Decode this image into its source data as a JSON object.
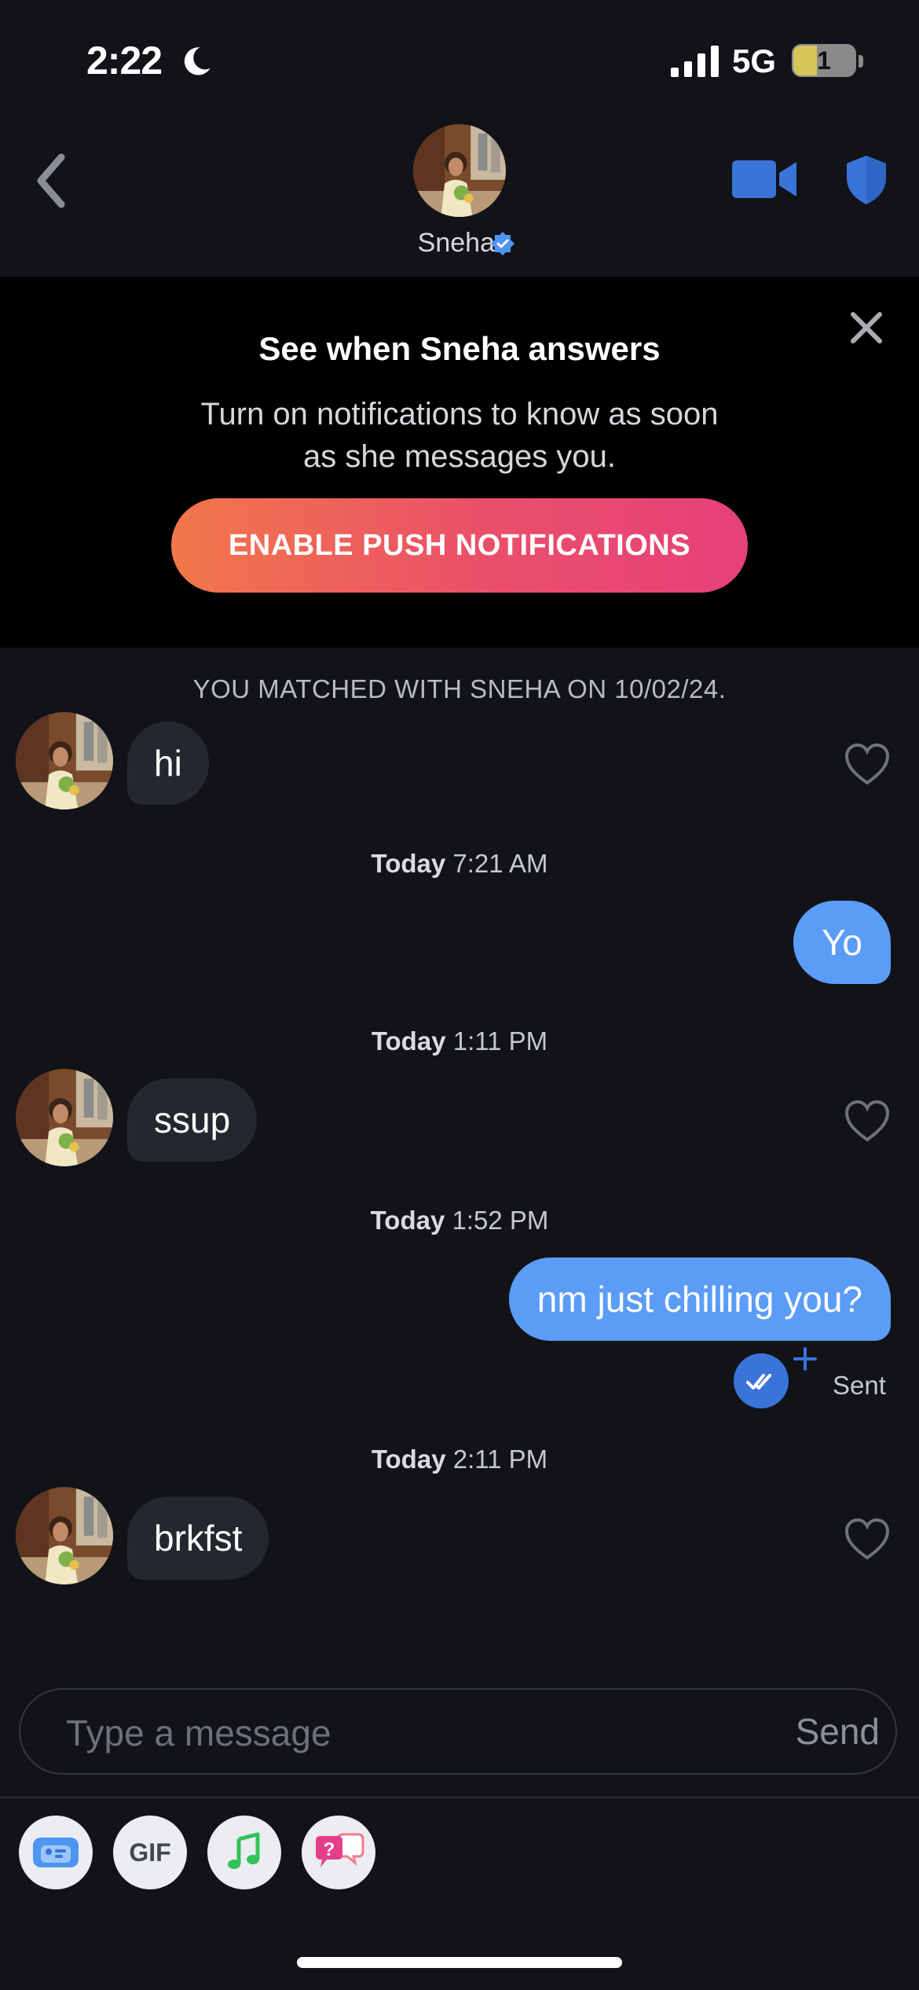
{
  "status_bar": {
    "time": "2:22",
    "network": "5G",
    "battery": "1"
  },
  "header": {
    "name": "Sneha"
  },
  "banner": {
    "title": "See when Sneha answers",
    "body": "Turn on notifications to know as soon as she messages you.",
    "button_label": "ENABLE PUSH NOTIFICATIONS"
  },
  "chat": {
    "matched_text": "YOU MATCHED WITH SNEHA ON 10/02/24.",
    "messages": [
      {
        "from": "them",
        "text": "hi"
      },
      {
        "day": "Today",
        "time": "7:21 AM"
      },
      {
        "from": "me",
        "text": "Yo"
      },
      {
        "day": "Today",
        "time": "1:11 PM"
      },
      {
        "from": "them",
        "text": "ssup"
      },
      {
        "day": "Today",
        "time": "1:52 PM"
      },
      {
        "from": "me",
        "text": "nm just chilling you?"
      },
      {
        "day": "Today",
        "time": "2:11 PM"
      },
      {
        "from": "them",
        "text": "brkfst"
      }
    ],
    "receipt_status": "Sent"
  },
  "composer": {
    "placeholder": "Type a message",
    "send_label": "Send"
  },
  "toolbar": {
    "gif_label": "GIF"
  },
  "colors": {
    "background": "#111318",
    "accent_blue": "#5b9cf6",
    "incoming_bubble": "#24272e",
    "cta_gradient_start": "#f2774a",
    "cta_gradient_end": "#e5417a"
  }
}
